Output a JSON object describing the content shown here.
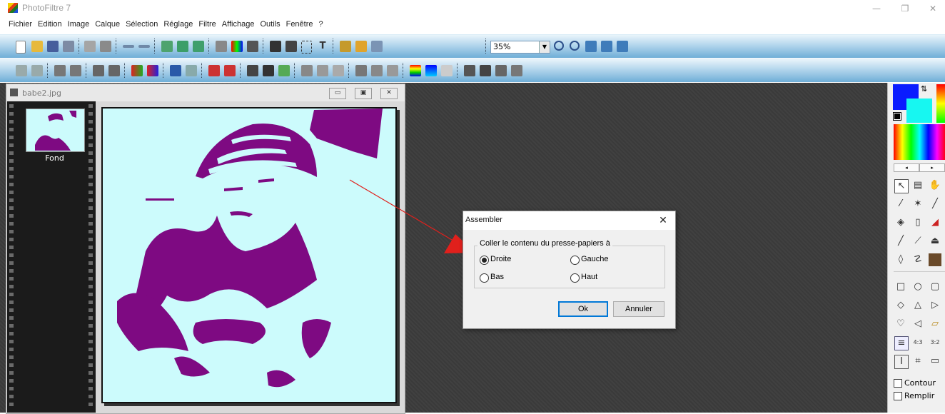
{
  "app": {
    "title": "PhotoFiltre 7"
  },
  "window_controls": {
    "minimize": "—",
    "maximize": "❐",
    "close": "✕"
  },
  "menu": [
    "Fichier",
    "Edition",
    "Image",
    "Calque",
    "Sélection",
    "Réglage",
    "Filtre",
    "Affichage",
    "Outils",
    "Fenêtre",
    "?"
  ],
  "toolbar": {
    "zoom": "35%"
  },
  "document": {
    "title": "babe2.jpg",
    "layer_label": "Fond",
    "buttons": {
      "min": "▭",
      "restore": "▣",
      "close": "✕"
    }
  },
  "palette": {
    "foreground_color": "#0a1cff",
    "background_color": "#17f7f1",
    "contour_label": "Contour",
    "remplir_label": "Remplir"
  },
  "image": {
    "fill_color": "#7e0a82",
    "background_color": "#ccfbfc"
  },
  "dialog": {
    "title": "Assembler",
    "close": "✕",
    "group_label": "Coller le contenu du presse-papiers à",
    "options": [
      {
        "label": "Droite",
        "checked": true
      },
      {
        "label": "Gauche",
        "checked": false
      },
      {
        "label": "Bas",
        "checked": false
      },
      {
        "label": "Haut",
        "checked": false
      }
    ],
    "ok_label": "Ok",
    "cancel_label": "Annuler"
  },
  "annotation": {
    "arrow_color": "#e0201c"
  }
}
